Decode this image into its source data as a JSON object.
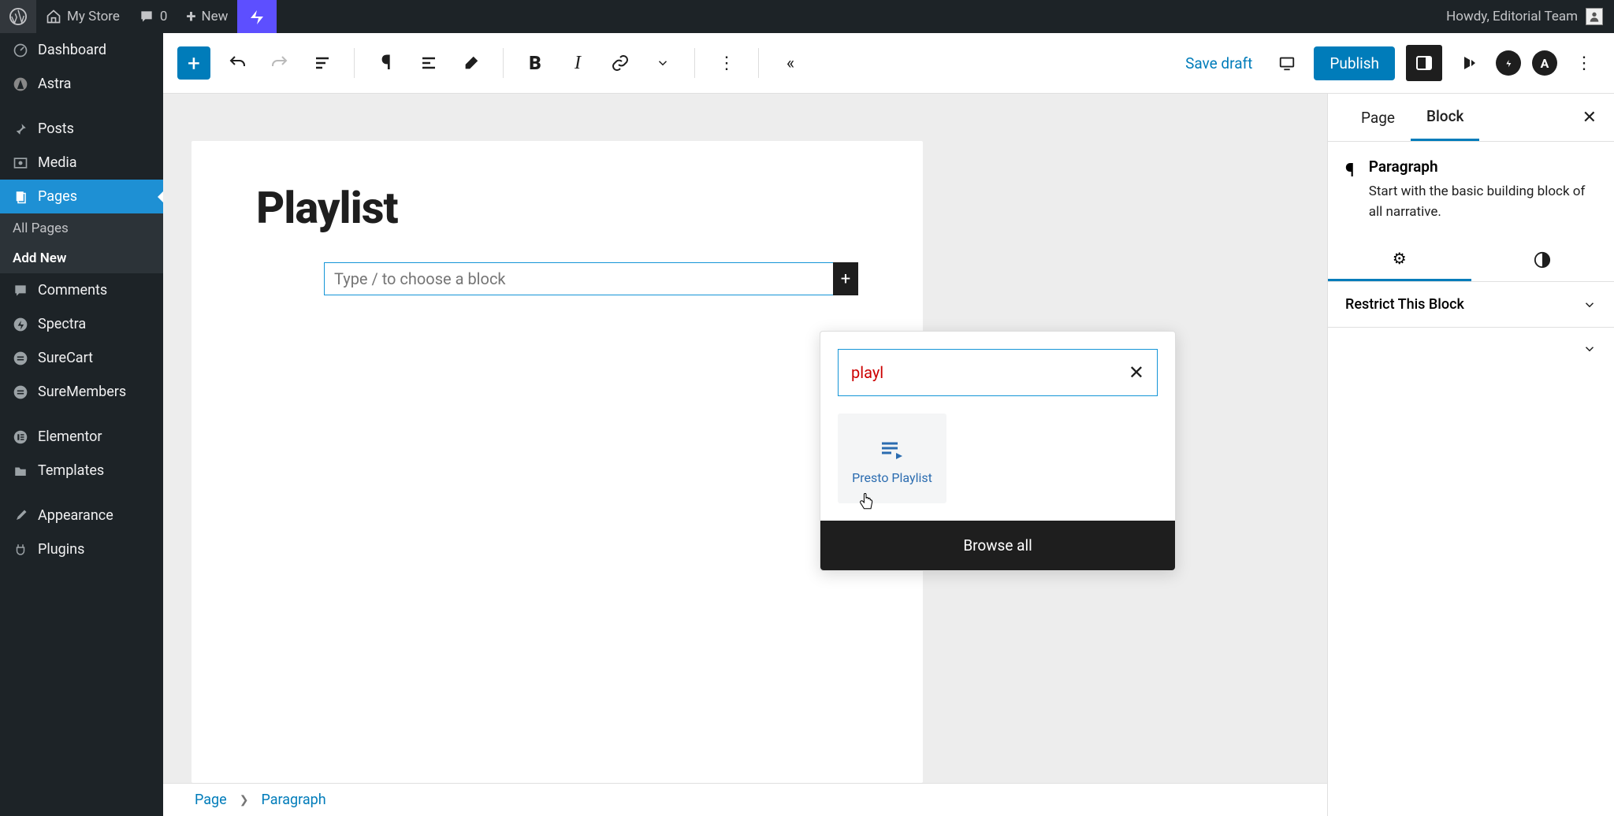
{
  "admin_bar": {
    "site_name": "My Store",
    "comments_count": "0",
    "new_label": "New",
    "howdy": "Howdy, Editorial Team"
  },
  "sidebar": {
    "items": [
      {
        "label": "Dashboard",
        "icon": "dashboard"
      },
      {
        "label": "Astra",
        "icon": "astra"
      },
      {
        "label": "Posts",
        "icon": "pin"
      },
      {
        "label": "Media",
        "icon": "media"
      },
      {
        "label": "Pages",
        "icon": "pages",
        "active": true
      },
      {
        "label": "Comments",
        "icon": "comment"
      },
      {
        "label": "Spectra",
        "icon": "spectra"
      },
      {
        "label": "SureCart",
        "icon": "surecart"
      },
      {
        "label": "SureMembers",
        "icon": "suremembers"
      },
      {
        "label": "Elementor",
        "icon": "elementor"
      },
      {
        "label": "Templates",
        "icon": "folder"
      },
      {
        "label": "Appearance",
        "icon": "brush"
      },
      {
        "label": "Plugins",
        "icon": "plug"
      }
    ],
    "sub": {
      "all_pages": "All Pages",
      "add_new": "Add New"
    }
  },
  "toolbar": {
    "save_draft": "Save draft",
    "publish": "Publish"
  },
  "canvas": {
    "title": "Playlist",
    "placeholder": "Type / to choose a block"
  },
  "breadcrumb": {
    "page": "Page",
    "block": "Paragraph"
  },
  "settings": {
    "tabs": {
      "page": "Page",
      "block": "Block"
    },
    "block_name": "Paragraph",
    "block_desc": "Start with the basic building block of all narrative.",
    "restrict_label": "Restrict This Block"
  },
  "inserter": {
    "search_value": "playl",
    "result_label": "Presto Playlist",
    "browse_all": "Browse all"
  }
}
